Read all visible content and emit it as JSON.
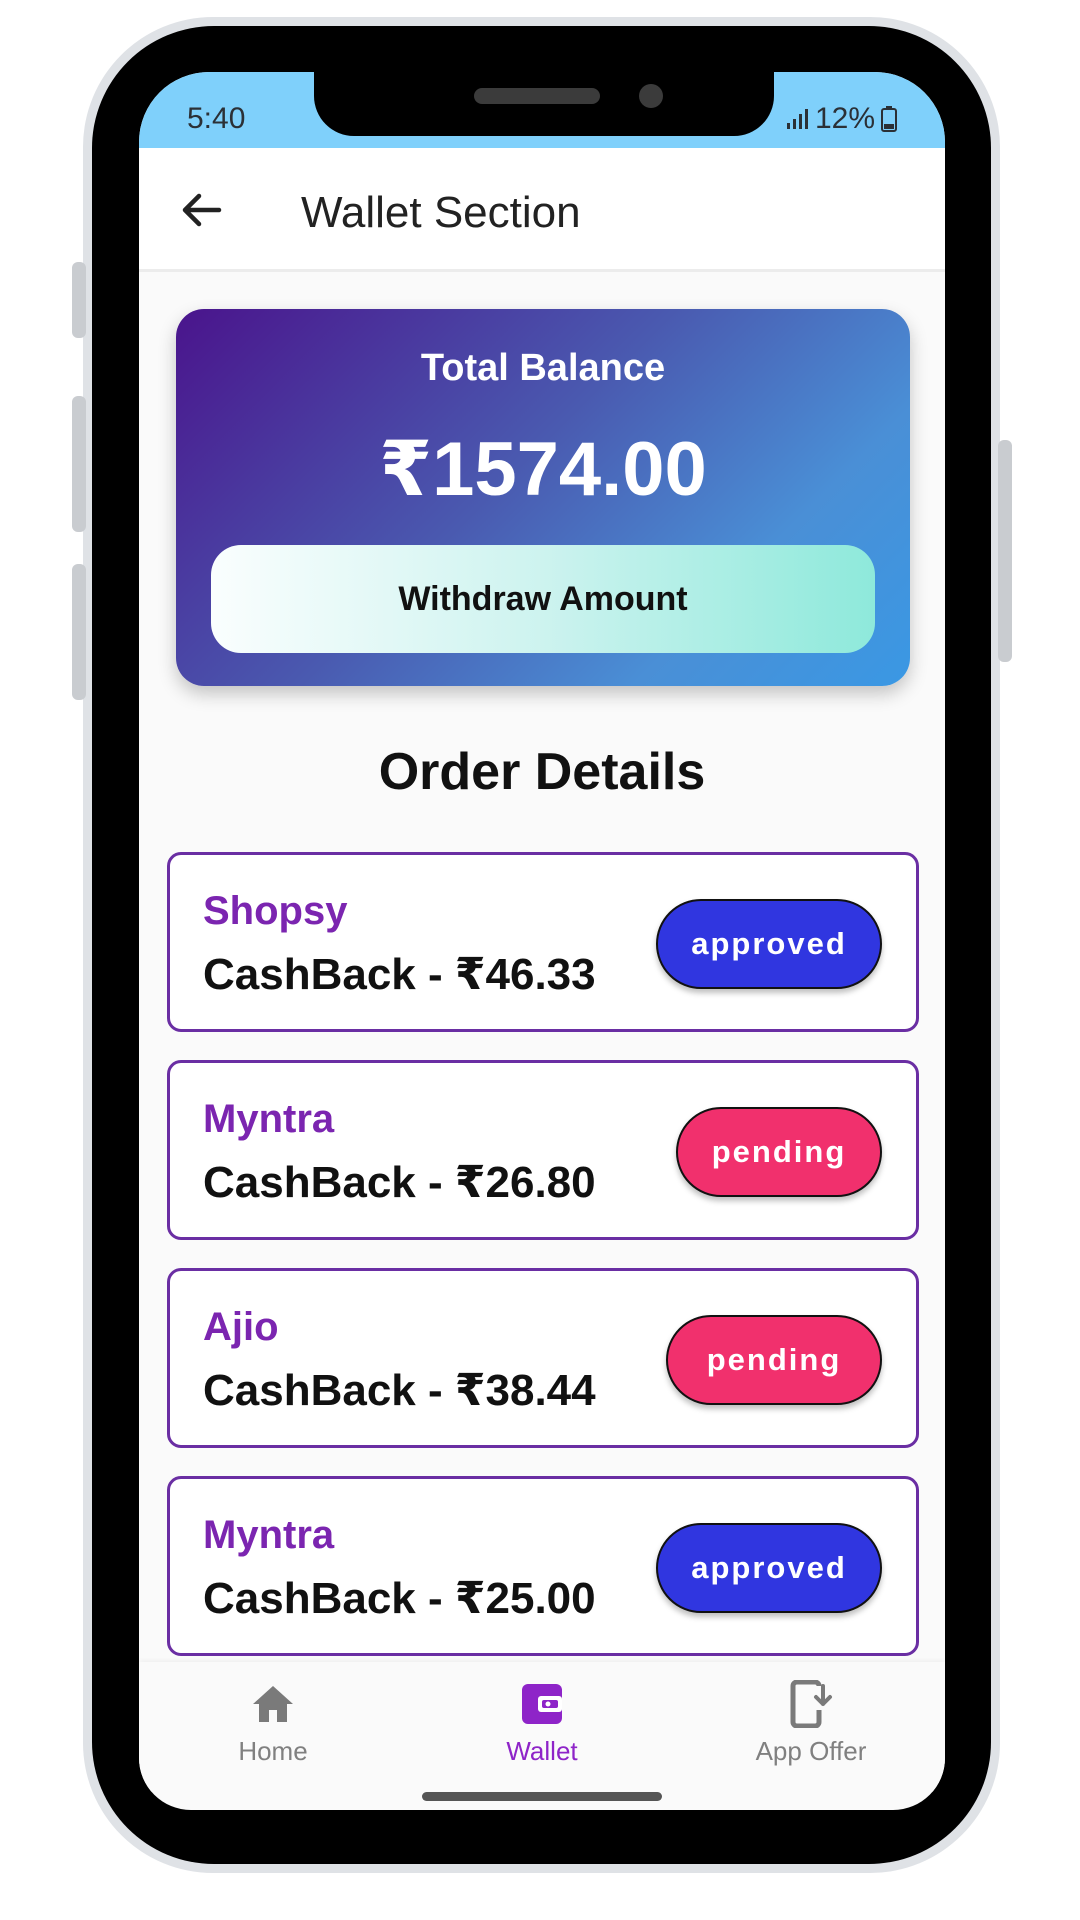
{
  "status_bar": {
    "time": "5:40",
    "battery": "12%",
    "signal_icon": "signal-icon",
    "battery_icon": "battery-icon"
  },
  "app_bar": {
    "title": "Wallet Section",
    "back_icon": "back-arrow-icon"
  },
  "balance": {
    "label": "Total Balance",
    "amount": "₹1574.00",
    "withdraw_label": "Withdraw Amount"
  },
  "orders_heading": "Order Details",
  "orders": [
    {
      "store": "Shopsy",
      "cashback": "CashBack - ₹46.33",
      "status": "approved"
    },
    {
      "store": "Myntra",
      "cashback": "CashBack - ₹26.80",
      "status": "pending"
    },
    {
      "store": "Ajio",
      "cashback": "CashBack - ₹38.44",
      "status": "pending"
    },
    {
      "store": "Myntra",
      "cashback": "CashBack - ₹25.00",
      "status": "approved"
    }
  ],
  "bottom_nav": {
    "items": [
      {
        "label": "Home",
        "icon": "home-icon",
        "active": false
      },
      {
        "label": "Wallet",
        "icon": "wallet-icon",
        "active": true
      },
      {
        "label": "App Offer",
        "icon": "app-download-icon",
        "active": false
      }
    ]
  },
  "colors": {
    "status_bar": "#7fd0fb",
    "store_name": "#7b25b0",
    "approved": "#3036e0",
    "pending": "#f1306d",
    "nav_active": "#8e24c8",
    "card_border": "#6a2ea3"
  }
}
